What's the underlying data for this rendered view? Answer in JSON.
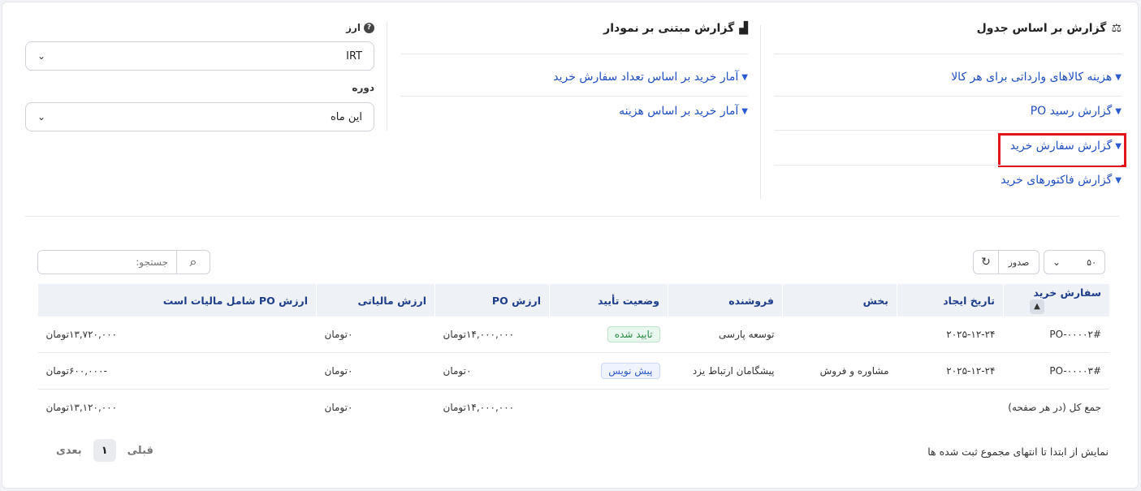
{
  "table_report": {
    "title": "گزارش بر اساس جدول",
    "links": [
      "هزینه کالاهای وارداتی برای هر کالا",
      "گزارش رسید PO",
      "گزارش سفارش خرید",
      "گزارش فاکتورهای خرید"
    ]
  },
  "chart_report": {
    "title": "گزارش مبتنی بر نمودار",
    "links": [
      "آمار خرید بر اساس تعداد سفارش خرید",
      "آمار خرید بر اساس هزینه"
    ]
  },
  "filters": {
    "currency_label": "ارز",
    "currency_value": "IRT",
    "period_label": "دوره",
    "period_value": "این ماه"
  },
  "toolbar": {
    "page_size": "۵۰",
    "export_label": "صدور",
    "search_placeholder": "جستجو:"
  },
  "table": {
    "headers": [
      "سفارش خرید",
      "تاریخ ایجاد",
      "بخش",
      "فروشنده",
      "وضعیت تأیید",
      "ارزش PO",
      "ارزش مالیاتی",
      "ارزش PO شامل مالیات است"
    ],
    "rows": [
      {
        "po": "#PO-۰۰۰۰۲",
        "date": "۲۰۲۵-۱۲-۲۴",
        "dept": "",
        "vendor": "توسعه پارسی",
        "status": "تایید شده",
        "po_value": "۱۴,۰۰۰,۰۰۰تومان",
        "tax": "۰تومان",
        "total": "۱۳,۷۲۰,۰۰۰تومان"
      },
      {
        "po": "#PO-۰۰۰۰۳",
        "date": "۲۰۲۵-۱۲-۲۴",
        "dept": "مشاوره و فروش",
        "vendor": "پیشگامان ارتباط یزد",
        "status": "پیش نویس",
        "po_value": "۰تومان",
        "tax": "۰تومان",
        "total": "-۶۰۰,۰۰۰تومان"
      }
    ],
    "footer": {
      "label": "جمع کل (در هر صفحه)",
      "po_value": "۱۴,۰۰۰,۰۰۰تومان",
      "tax": "۰تومان",
      "total": "۱۳,۱۲۰,۰۰۰تومان"
    }
  },
  "pagination": {
    "info": "نمایش از ابتدا تا انتهای مجموع ثبت شده ها",
    "prev": "قبلی",
    "page": "۱",
    "next": "بعدی"
  }
}
